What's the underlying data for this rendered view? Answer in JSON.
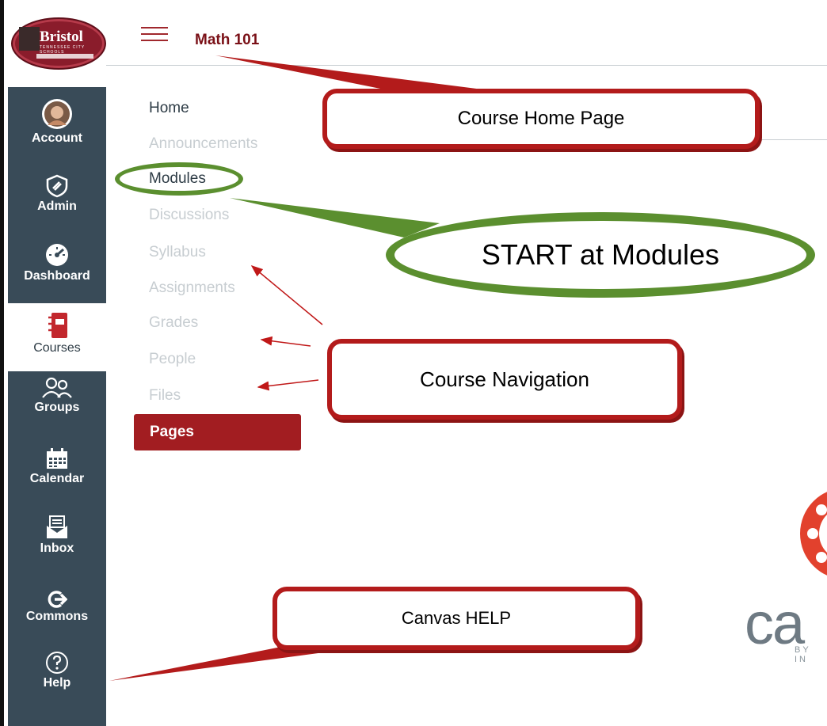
{
  "header": {
    "course_title": "Math 101"
  },
  "logo": {
    "text": "Bristol",
    "subtext": "TENNESSEE CITY SCHOOLS"
  },
  "global_nav": {
    "items": [
      {
        "label": "Account",
        "icon": "avatar"
      },
      {
        "label": "Admin",
        "icon": "shield-icon"
      },
      {
        "label": "Dashboard",
        "icon": "dashboard-icon"
      },
      {
        "label": "Courses",
        "icon": "courses-icon"
      },
      {
        "label": "Groups",
        "icon": "groups-icon"
      },
      {
        "label": "Calendar",
        "icon": "calendar-icon"
      },
      {
        "label": "Inbox",
        "icon": "inbox-icon"
      },
      {
        "label": "Commons",
        "icon": "commons-icon"
      },
      {
        "label": "Help",
        "icon": "help-icon"
      }
    ]
  },
  "course_nav": {
    "items": [
      "Home",
      "Announcements",
      "Modules",
      "Discussions",
      "Syllabus",
      "Assignments",
      "Grades",
      "People",
      "Files",
      "Pages"
    ],
    "active": "Pages"
  },
  "annotations": {
    "course_home_page": "Course Home Page",
    "start_at_modules": "START at Modules",
    "course_navigation": "Course Navigation",
    "canvas_help": "Canvas HELP"
  },
  "brand": {
    "wordmark": "ca",
    "byline": "BY IN"
  },
  "colors": {
    "rail": "#394b58",
    "accent": "#a21d21",
    "callout_border": "#b31b1b",
    "oval_green": "#5b8f2f"
  }
}
